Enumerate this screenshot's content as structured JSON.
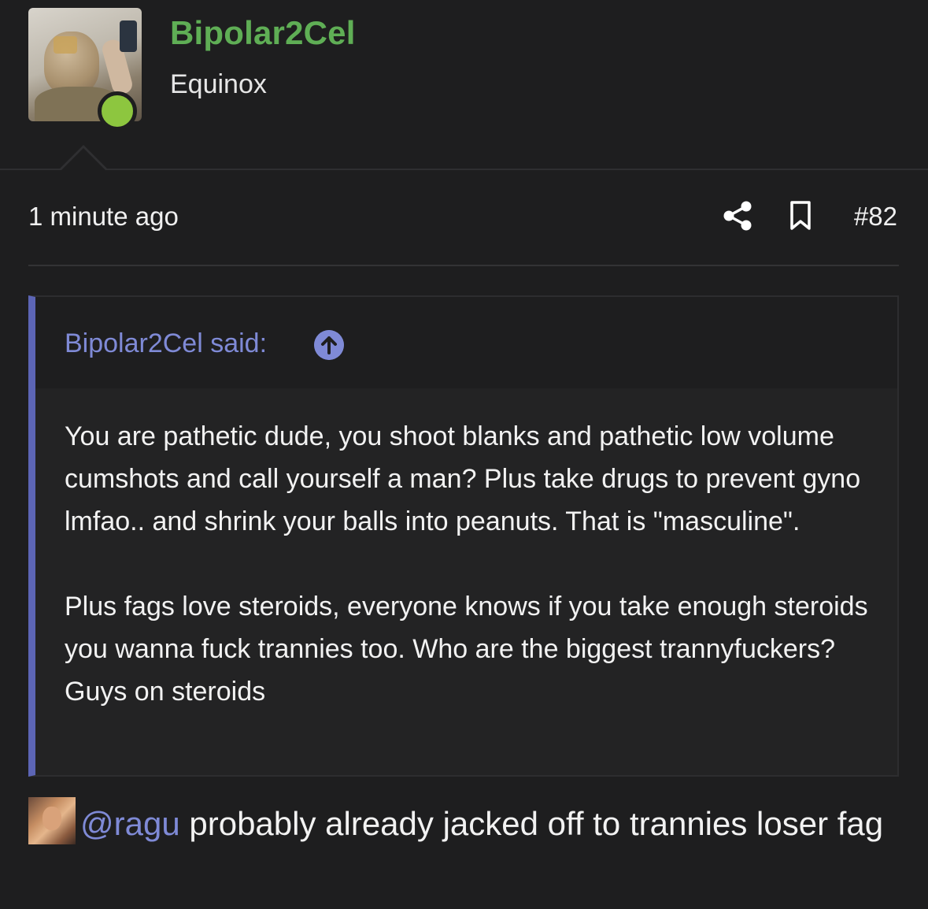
{
  "author": {
    "username": "Bipolar2Cel",
    "user_title": "Equinox",
    "online": true
  },
  "meta": {
    "timestamp": "1 minute ago",
    "post_number": "#82",
    "icons": [
      "share-icon",
      "bookmark-icon"
    ]
  },
  "quote": {
    "attribution": "Bipolar2Cel said:",
    "paragraphs": [
      "You are pathetic dude, you shoot blanks and pathetic low volume cumshots and call yourself a man? Plus take drugs to prevent gyno lmfao.. and shrink your balls into peanuts. That is \"masculine\".",
      "Plus fags love steroids, everyone knows if you take enough steroids you wanna fuck trannies too. Who are the biggest trannyfuckers? Guys on steroids"
    ]
  },
  "reply": {
    "mention": "@ragu",
    "text": " probably already jacked off to trannies loser fag"
  },
  "colors": {
    "background": "#1e1e1f",
    "username": "#5fae55",
    "accent": "#7f8ad6",
    "quote_bar": "#5c65b5",
    "online": "#8dc63f"
  }
}
